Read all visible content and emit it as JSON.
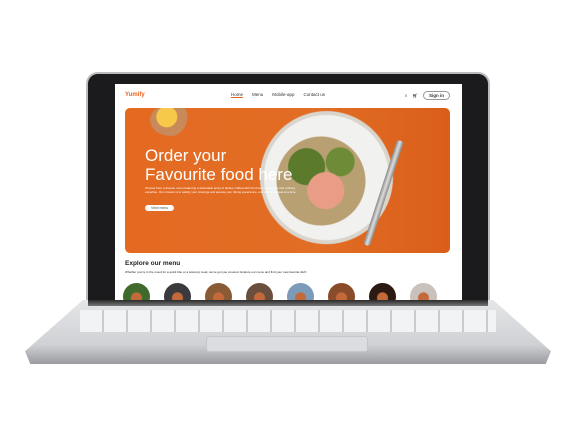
{
  "nav": {
    "logo": "Yumify",
    "links": [
      "Home",
      "Menu",
      "Mobile-app",
      "Contact us"
    ],
    "signin": "Sign in"
  },
  "hero": {
    "title_line1": "Order your",
    "title_line2": "Favourite food here",
    "description": "Choose from a diverse menu featuring a delectable array of dishes crafted with the finest ingredients and culinary expertise. Our mission is to satisfy your cravings and elevate your dining experience, one delicious meal at a time.",
    "button": "View menu"
  },
  "explore": {
    "title": "Explore our menu",
    "subtitle": "Whether you're in the mood for a quick bite or a leisurely meal, we've got you covered. Explore our menu and find your new favorite dish!"
  },
  "colors": {
    "accent": "#e8621f",
    "categories": [
      "#3f6a2c",
      "#3a3a3e",
      "#8a5a35",
      "#6b4f3e",
      "#7b9bb8",
      "#8a4b2a",
      "#2a1a12",
      "#c9c2bc"
    ]
  }
}
